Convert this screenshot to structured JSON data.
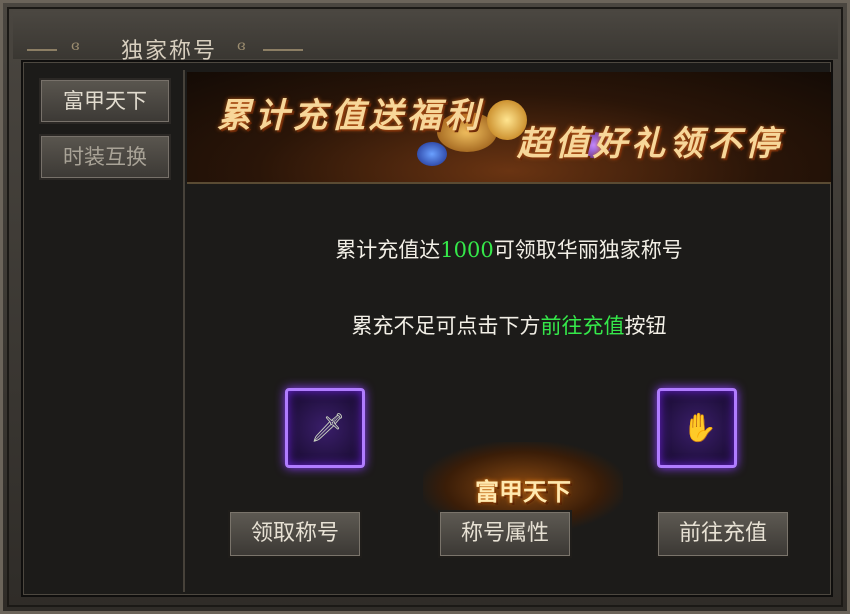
{
  "window": {
    "title": "独家称号"
  },
  "sidebar": {
    "items": [
      {
        "label": "富甲天下"
      },
      {
        "label": "时装互换"
      }
    ]
  },
  "banner": {
    "line1": "累计充值送福利",
    "line2": "超值好礼领不停"
  },
  "message": {
    "line1_prefix": "累计充值达",
    "line1_amount": "1000",
    "line1_suffix": "可领取华丽独家称号",
    "line2_prefix": "累充不足可点击下方",
    "line2_highlight": "前往充值",
    "line2_suffix": "按钮"
  },
  "title_badge": {
    "text": "富甲天下"
  },
  "slots": [
    {
      "icon": "sword-icon"
    },
    {
      "icon": "gauntlet-icon"
    }
  ],
  "buttons": {
    "claim": "领取称号",
    "attributes": "称号属性",
    "recharge": "前往充值"
  },
  "colors": {
    "highlight": "#35e84a",
    "slot_glow": "#8d3cff"
  }
}
